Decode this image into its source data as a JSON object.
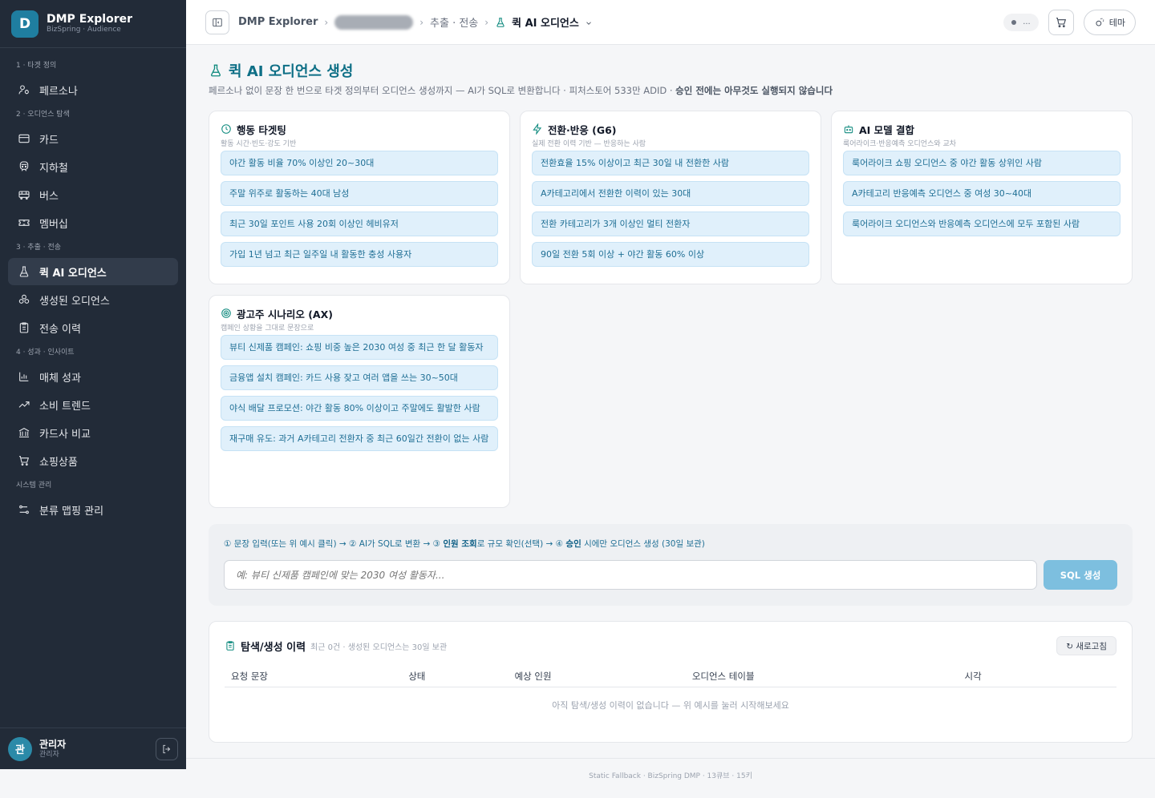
{
  "brand": {
    "logo": "D",
    "title": "DMP Explorer",
    "subtitle": "BizSpring · Audience"
  },
  "sidebar": {
    "sections": [
      {
        "label": "1 · 타겟 정의",
        "items": [
          {
            "label": "페르소나",
            "icon": "persona-icon"
          }
        ]
      },
      {
        "label": "2 · 오디언스 탐색",
        "items": [
          {
            "label": "카드",
            "icon": "card-icon"
          },
          {
            "label": "지하철",
            "icon": "subway-icon"
          },
          {
            "label": "버스",
            "icon": "bus-icon"
          },
          {
            "label": "멤버십",
            "icon": "ticket-icon"
          }
        ]
      },
      {
        "label": "3 · 추출 · 전송",
        "items": [
          {
            "label": "퀵 AI 오디언스",
            "icon": "flask-icon",
            "active": true
          },
          {
            "label": "생성된 오디언스",
            "icon": "cluster-icon"
          },
          {
            "label": "전송 이력",
            "icon": "clipboard-icon"
          }
        ]
      },
      {
        "label": "4 · 성과 · 인사이트",
        "items": [
          {
            "label": "매체 성과",
            "icon": "bar-chart-icon"
          },
          {
            "label": "소비 트렌드",
            "icon": "trend-icon"
          },
          {
            "label": "카드사 비교",
            "icon": "bank-icon"
          },
          {
            "label": "쇼핑상품",
            "icon": "cart-icon"
          }
        ]
      },
      {
        "label": "시스템 관리",
        "items": [
          {
            "label": "분류 맵핑 관리",
            "icon": "mapping-icon"
          }
        ]
      }
    ]
  },
  "user": {
    "avatar": "관",
    "name": "관리자",
    "role": "관리자"
  },
  "header": {
    "crumb_root": "DMP Explorer",
    "crumb_mid": "추출 · 전송",
    "crumb_current": "퀵 AI 오디언스",
    "status": "...",
    "theme_label": "테마"
  },
  "page": {
    "title": "퀵 AI 오디언스 생성",
    "desc_plain": "페르소나 없이 문장 한 번으로 타겟 정의부터 오디언스 생성까지 — AI가 SQL로 변환합니다 · 피처스토어 533만 ADID · ",
    "desc_bold": "승인 전에는 아무것도 실행되지 않습니다"
  },
  "cards": [
    {
      "title": "행동 타겟팅",
      "subtitle": "활동 시간·빈도·강도 기반",
      "icon": "clock-icon",
      "examples": [
        "야간 활동 비율 70% 이상인 20~30대",
        "주말 위주로 활동하는 40대 남성",
        "최근 30일 포인트 사용 20회 이상인 헤비유저",
        "가입 1년 넘고 최근 일주일 내 활동한 충성 사용자"
      ]
    },
    {
      "title": "전환·반응 (G6)",
      "subtitle": "실제 전환 이력 기반 — 반응하는 사람",
      "icon": "bolt-icon",
      "examples": [
        "전환효율 15% 이상이고 최근 30일 내 전환한 사람",
        "A카테고리에서 전환한 이력이 있는 30대",
        "전환 카테고리가 3개 이상인 멀티 전환자",
        "90일 전환 5회 이상 + 야간 활동 60% 이상"
      ]
    },
    {
      "title": "AI 모델 결합",
      "subtitle": "룩어라이크·반응예측 오디언스와 교차",
      "icon": "robot-icon",
      "examples": [
        "룩어라이크 쇼핑 오디언스 중 야간 활동 상위인 사람",
        "A카테고리 반응예측 오디언스 중 여성 30~40대",
        "룩어라이크 오디언스와 반응예측 오디언스에 모두 포함된 사람"
      ]
    },
    {
      "title": "광고주 시나리오 (AX)",
      "subtitle": "캠페인 상황을 그대로 문장으로",
      "icon": "target-icon",
      "examples": [
        "뷰티 신제품 캠페인: 쇼핑 비중 높은 2030 여성 중 최근 한 달 활동자",
        "금융앱 설치 캠페인: 카드 사용 잦고 여러 앱을 쓰는 30~50대",
        "야식 배달 프로모션: 야간 활동 80% 이상이고 주말에도 활발한 사람",
        "재구매 유도: 과거 A카테고리 전환자 중 최근 60일간 전환이 없는 사람"
      ]
    }
  ],
  "input_panel": {
    "steps": [
      {
        "text": "① 문장 입력(또는 위 예시 클릭) → ② AI가 SQL로 변환 → ③ ",
        "bold": false
      },
      {
        "text": "인원 조회",
        "bold": true
      },
      {
        "text": "로 규모 확인(선택) → ④ ",
        "bold": false
      },
      {
        "text": "승인",
        "bold": true
      },
      {
        "text": " 시에만 오디언스 생성 (30일 보관)",
        "bold": false
      }
    ],
    "placeholder": "예: 뷰티 신제품 캠페인에 맞는 2030 여성 활동자...",
    "button": "SQL 생성"
  },
  "history": {
    "title": "탐색/생성 이력",
    "subtitle": "최근 0건 · 생성된 오디언스는 30일 보관",
    "refresh": "↻ 새로고침",
    "columns": [
      "요청 문장",
      "상태",
      "예상 인원",
      "오디언스 테이블",
      "시각"
    ],
    "empty": "아직 탐색/생성 이력이 없습니다 — 위 예시를 눌러 시작해보세요"
  },
  "footer": "Static Fallback · BizSpring DMP · 13큐브 · 15키"
}
